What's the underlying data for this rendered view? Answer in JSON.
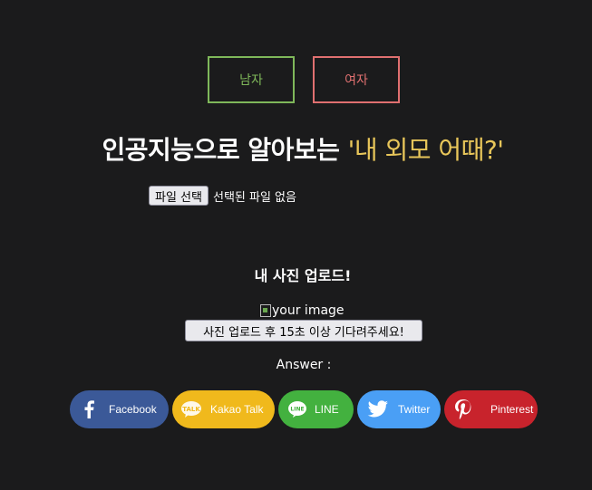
{
  "gender": {
    "male_label": "남자",
    "female_label": "여자"
  },
  "title": {
    "main": "인공지능으로 알아보는 ",
    "accent": "'내 외모 어때?'"
  },
  "file_input": {
    "button_label": "파일 선택",
    "status": "선택된 파일 없음"
  },
  "upload": {
    "title": "내 사진 업로드!",
    "image_alt": "your image",
    "wait_button_label": "사진 업로드 후 15초 이상 기다려주세요!"
  },
  "answer_label": "Answer :",
  "share": [
    {
      "label": "Facebook",
      "icon": "facebook-icon",
      "color": "#3b5998"
    },
    {
      "label": "Kakao Talk",
      "icon": "kakaotalk-icon",
      "color": "#f0b91c"
    },
    {
      "label": "LINE",
      "icon": "line-icon",
      "color": "#43b13f"
    },
    {
      "label": "Twitter",
      "icon": "twitter-icon",
      "color": "#4a9ff5"
    },
    {
      "label": "Pinterest",
      "icon": "pinterest-icon",
      "color": "#c8232c"
    }
  ],
  "colors": {
    "background": "#1b1b1c",
    "male": "#7fb85a",
    "female": "#e07070",
    "accent": "#e8c65a"
  }
}
